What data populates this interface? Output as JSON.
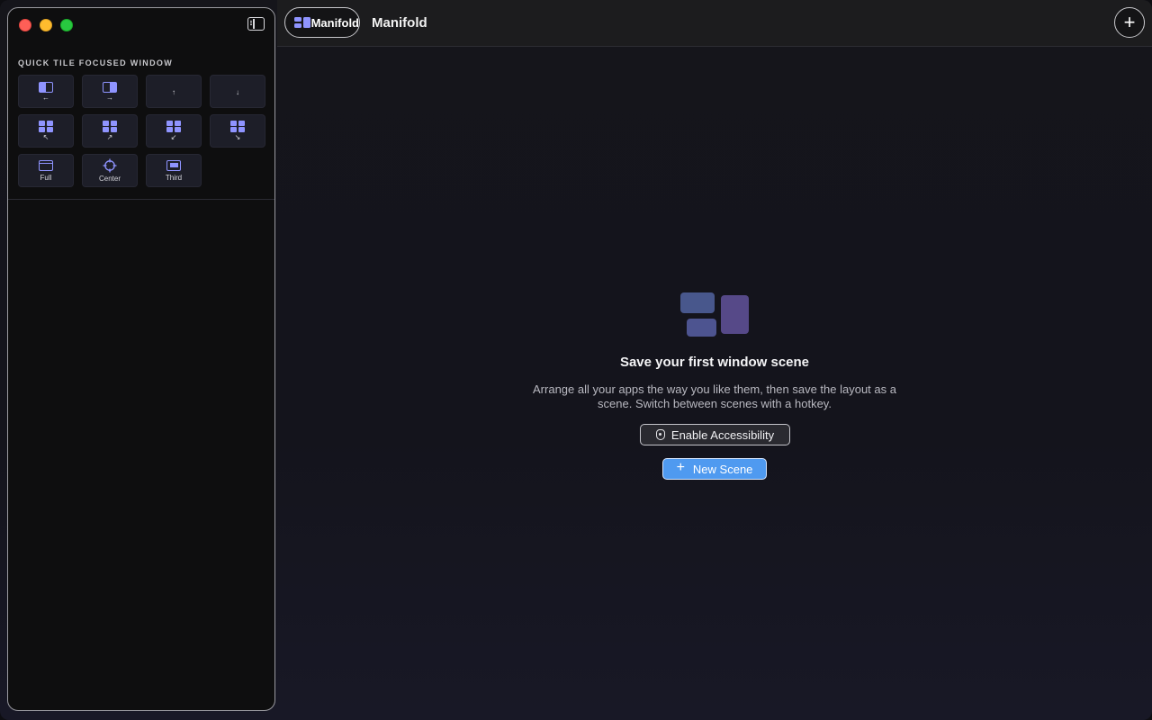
{
  "sidebar": {
    "section_title": "QUICK TILE FOCUSED WINDOW",
    "tiles": [
      {
        "icon": "left-half-icon",
        "caption": "←"
      },
      {
        "icon": "right-half-icon",
        "caption": "→"
      },
      {
        "icon": "up-arrow-icon",
        "caption": "↑"
      },
      {
        "icon": "down-arrow-icon",
        "caption": "↓"
      },
      {
        "icon": "top-left-quarter-icon",
        "caption": "↖"
      },
      {
        "icon": "top-right-quarter-icon",
        "caption": "↗"
      },
      {
        "icon": "bottom-left-quarter-icon",
        "caption": "↙"
      },
      {
        "icon": "bottom-right-quarter-icon",
        "caption": "↘"
      },
      {
        "icon": "full-window-icon",
        "caption": "Full"
      },
      {
        "icon": "crosshair-icon",
        "caption": "Center"
      },
      {
        "icon": "third-window-icon",
        "caption": "Third"
      }
    ]
  },
  "header": {
    "pill_label": "Manifold",
    "title": "Manifold",
    "add_icon": "plus-icon"
  },
  "empty_state": {
    "icon": "window-layout-icon",
    "title": "Save your first window scene",
    "description": "Arrange all your apps the way you like them, then save the layout as a scene. Switch between scenes with a hotkey.",
    "accessibility_label": "Enable Accessibility",
    "new_scene_label": "New Scene"
  },
  "colors": {
    "accent": "#8f94ff",
    "button_blue": "#4f9af0",
    "hero_blue": "#4a5a90",
    "hero_purple": "#56468a"
  }
}
